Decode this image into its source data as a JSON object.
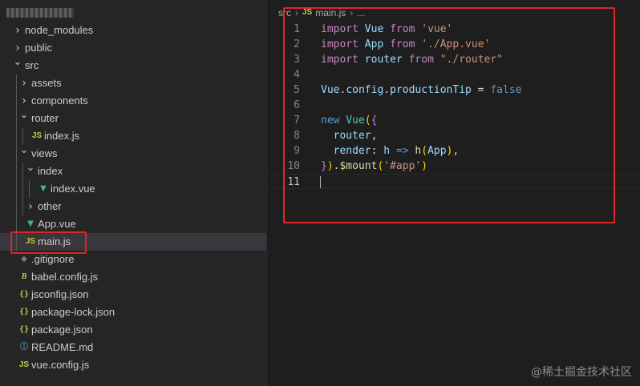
{
  "explorer": {
    "items": [
      {
        "label": "node_modules",
        "kind": "folder",
        "expanded": false,
        "depth": 0
      },
      {
        "label": "public",
        "kind": "folder",
        "expanded": false,
        "depth": 0
      },
      {
        "label": "src",
        "kind": "folder",
        "expanded": true,
        "depth": 0
      },
      {
        "label": "assets",
        "kind": "folder",
        "expanded": false,
        "depth": 1
      },
      {
        "label": "components",
        "kind": "folder",
        "expanded": false,
        "depth": 1
      },
      {
        "label": "router",
        "kind": "folder",
        "expanded": true,
        "depth": 1
      },
      {
        "label": "index.js",
        "kind": "js",
        "depth": 2
      },
      {
        "label": "views",
        "kind": "folder",
        "expanded": true,
        "depth": 1
      },
      {
        "label": "index",
        "kind": "folder",
        "expanded": true,
        "depth": 2
      },
      {
        "label": "index.vue",
        "kind": "vue",
        "depth": 3
      },
      {
        "label": "other",
        "kind": "folder",
        "expanded": false,
        "depth": 2
      },
      {
        "label": "App.vue",
        "kind": "vue",
        "depth": 1
      },
      {
        "label": "main.js",
        "kind": "js",
        "depth": 1,
        "selected": true
      },
      {
        "label": ".gitignore",
        "kind": "git",
        "depth": 0
      },
      {
        "label": "babel.config.js",
        "kind": "babel",
        "depth": 0
      },
      {
        "label": "jsconfig.json",
        "kind": "json",
        "depth": 0
      },
      {
        "label": "package-lock.json",
        "kind": "json",
        "depth": 0
      },
      {
        "label": "package.json",
        "kind": "json",
        "depth": 0
      },
      {
        "label": "README.md",
        "kind": "info",
        "depth": 0
      },
      {
        "label": "vue.config.js",
        "kind": "js",
        "depth": 0
      }
    ]
  },
  "icons": {
    "folder_collapsed": "chevron-right-icon",
    "folder_expanded": "chevron-down-icon",
    "js": "js-file-icon",
    "vue": "vue-file-icon",
    "json": "json-file-icon",
    "git": "git-file-icon",
    "babel": "babel-file-icon",
    "info": "info-file-icon"
  },
  "editor": {
    "breadcrumb": {
      "folder": "src",
      "file": "main.js",
      "more": "..."
    },
    "active_line": 11,
    "lines": [
      [
        {
          "t": "import",
          "c": "kwc"
        },
        {
          "t": " "
        },
        {
          "t": "Vue",
          "c": "var"
        },
        {
          "t": " "
        },
        {
          "t": "from",
          "c": "kwc"
        },
        {
          "t": " "
        },
        {
          "t": "'vue'",
          "c": "str"
        }
      ],
      [
        {
          "t": "import",
          "c": "kwc"
        },
        {
          "t": " "
        },
        {
          "t": "App",
          "c": "var"
        },
        {
          "t": " "
        },
        {
          "t": "from",
          "c": "kwc"
        },
        {
          "t": " "
        },
        {
          "t": "'./App.vue'",
          "c": "str"
        }
      ],
      [
        {
          "t": "import",
          "c": "kwc"
        },
        {
          "t": " "
        },
        {
          "t": "router",
          "c": "var"
        },
        {
          "t": " "
        },
        {
          "t": "from",
          "c": "kwc"
        },
        {
          "t": " "
        },
        {
          "t": "\"./router\"",
          "c": "str"
        }
      ],
      [],
      [
        {
          "t": "Vue",
          "c": "var"
        },
        {
          "t": "."
        },
        {
          "t": "config",
          "c": "var"
        },
        {
          "t": "."
        },
        {
          "t": "productionTip",
          "c": "var"
        },
        {
          "t": " = "
        },
        {
          "t": "false",
          "c": "kw"
        }
      ],
      [],
      [
        {
          "t": "new",
          "c": "kw"
        },
        {
          "t": " "
        },
        {
          "t": "Vue",
          "c": "cls"
        },
        {
          "t": "(",
          "c": "br1"
        },
        {
          "t": "{",
          "c": "br2"
        }
      ],
      [
        {
          "t": "  "
        },
        {
          "t": "router",
          "c": "var"
        },
        {
          "t": ","
        }
      ],
      [
        {
          "t": "  "
        },
        {
          "t": "render",
          "c": "var"
        },
        {
          "t": ": "
        },
        {
          "t": "h",
          "c": "var"
        },
        {
          "t": " "
        },
        {
          "t": "=>",
          "c": "kw"
        },
        {
          "t": " "
        },
        {
          "t": "h",
          "c": "fn"
        },
        {
          "t": "(",
          "c": "br1"
        },
        {
          "t": "App",
          "c": "var"
        },
        {
          "t": ")",
          "c": "br1"
        },
        {
          "t": ","
        }
      ],
      [
        {
          "t": "}",
          "c": "br2"
        },
        {
          "t": ")",
          "c": "br1"
        },
        {
          "t": "."
        },
        {
          "t": "$mount",
          "c": "fn"
        },
        {
          "t": "(",
          "c": "br1"
        },
        {
          "t": "'#app'",
          "c": "str"
        },
        {
          "t": ")",
          "c": "br1"
        }
      ],
      []
    ]
  },
  "watermark": "@稀土掘金技术社区",
  "colors": {
    "annotation_red": "#e02424",
    "background": "#1e1e1e",
    "sidebar": "#252526"
  }
}
